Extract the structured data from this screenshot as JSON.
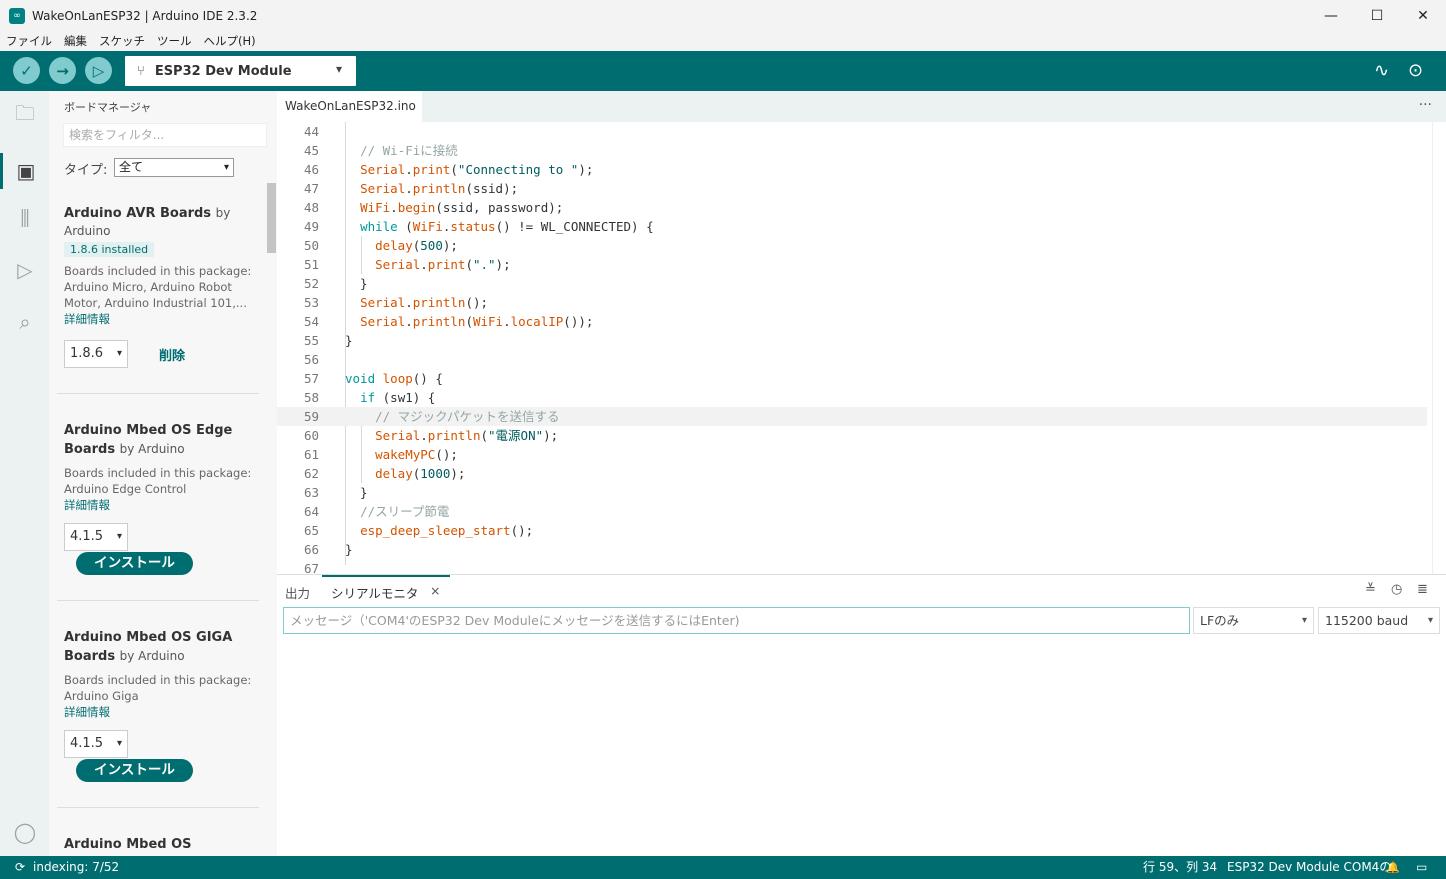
{
  "window": {
    "title": "WakeOnLanESP32 | Arduino IDE 2.3.2",
    "logo_glyph": "∞",
    "minimize": "—",
    "maximize": "☐",
    "close": "✕"
  },
  "menu": [
    "ファイル",
    "編集",
    "スケッチ",
    "ツール",
    "ヘルプ(H)"
  ],
  "toolbar": {
    "verify_icon": "✓",
    "upload_icon": "→",
    "debug_icon": "▷",
    "board_icon": "⑂",
    "board": "ESP32 Dev Module",
    "board_arrow": "▾",
    "plotter_icon": "∿",
    "monitor_icon": "⊙"
  },
  "activity": {
    "sketchbook_icon": "🗀",
    "boards_icon": "▣",
    "library_icon": "⫼",
    "debug_icon": "▷",
    "search_icon": "⌕",
    "account_icon": "◯"
  },
  "board_manager": {
    "title": "ボードマネージャ",
    "filter_placeholder": "検索をフィルタ...",
    "type_label": "タイプ:",
    "type_value": "全て",
    "dropdown_arrow": "▾",
    "packages": [
      {
        "name": "Arduino AVR Boards",
        "by": "by",
        "author": "Arduino",
        "badge": "1.8.6 installed",
        "desc": "Boards included in this package: Arduino Micro, Arduino Robot Motor, Arduino Industrial 101,...",
        "more": "詳細情報",
        "version": "1.8.6",
        "action": "削除"
      },
      {
        "name": "Arduino Mbed OS Edge",
        "name2": "Boards",
        "by": "by Arduino",
        "desc": "Boards included in this package: Arduino Edge Control",
        "more": "詳細情報",
        "version": "4.1.5",
        "action": "インストール"
      },
      {
        "name": "Arduino Mbed OS GIGA",
        "name2": "Boards",
        "by": "by Arduino",
        "desc": "Boards included in this package: Arduino Giga",
        "more": "詳細情報",
        "version": "4.1.5",
        "action": "インストール"
      },
      {
        "name": "Arduino Mbed OS"
      }
    ]
  },
  "editor": {
    "tab": "WakeOnLanESP32.ino",
    "more_icon": "···",
    "current_line": 59,
    "lines": [
      {
        "n": "44",
        "html": ""
      },
      {
        "n": "45",
        "html": "  <span class=\"cm\">// Wi-Fiに接続</span>"
      },
      {
        "n": "46",
        "html": "  <span class=\"fn\">Serial</span>.<span class=\"fn\">print</span>(<span class=\"str\">\"Connecting to \"</span>);"
      },
      {
        "n": "47",
        "html": "  <span class=\"fn\">Serial</span>.<span class=\"fn\">println</span>(ssid);"
      },
      {
        "n": "48",
        "html": "  <span class=\"fn\">WiFi</span>.<span class=\"fn\">begin</span>(ssid, password);"
      },
      {
        "n": "49",
        "html": "  <span class=\"kw\">while</span> (<span class=\"fn\">WiFi</span>.<span class=\"fn\">status</span>() != WL_CONNECTED) {"
      },
      {
        "n": "50",
        "html": "    <span class=\"fn\">delay</span>(<span class=\"str\">500</span>);"
      },
      {
        "n": "51",
        "html": "    <span class=\"fn\">Serial</span>.<span class=\"fn\">print</span>(<span class=\"str\">\".\"</span>);"
      },
      {
        "n": "52",
        "html": "  }"
      },
      {
        "n": "53",
        "html": "  <span class=\"fn\">Serial</span>.<span class=\"fn\">println</span>();"
      },
      {
        "n": "54",
        "html": "  <span class=\"fn\">Serial</span>.<span class=\"fn\">println</span>(<span class=\"fn\">WiFi</span>.<span class=\"fn\">localIP</span>());"
      },
      {
        "n": "55",
        "html": "}"
      },
      {
        "n": "56",
        "html": ""
      },
      {
        "n": "57",
        "html": "<span class=\"kw\">void</span> <span class=\"fn\">loop</span>() {"
      },
      {
        "n": "58",
        "html": "  <span class=\"kw\">if</span> (sw1) {"
      },
      {
        "n": "59",
        "html": "    <span class=\"cm\">// マジックパケットを送信する</span>"
      },
      {
        "n": "60",
        "html": "    <span class=\"fn\">Serial</span>.<span class=\"fn\">println</span>(<span class=\"str\">\"電源ON\"</span>);"
      },
      {
        "n": "61",
        "html": "    <span class=\"fn\">wakeMyPC</span>();"
      },
      {
        "n": "62",
        "html": "    <span class=\"fn\">delay</span>(<span class=\"str\">1000</span>);"
      },
      {
        "n": "63",
        "html": "  }"
      },
      {
        "n": "64",
        "html": "  <span class=\"cm\">//スリープ節電</span>"
      },
      {
        "n": "65",
        "html": "  <span class=\"fn\">esp_deep_sleep_start</span>();"
      },
      {
        "n": "66",
        "html": "}"
      },
      {
        "n": "67",
        "html": ""
      }
    ]
  },
  "panel": {
    "output_tab": "出力",
    "monitor_tab": "シリアルモニタ",
    "close_icon": "×",
    "collapse_icon": "≚",
    "timestamp_icon": "◷",
    "clear_icon": "≣",
    "message_placeholder": "メッセージ（'COM4'のESP32 Dev Moduleにメッセージを送信するにはEnter)",
    "line_ending": "LFのみ",
    "baud": "115200 baud",
    "dropdown_arrow": "▾"
  },
  "status": {
    "sync_icon": "⟳",
    "indexing": "indexing: 7/52",
    "cursor": "行 59、列 34",
    "board_port": "ESP32 Dev Module COM4の",
    "bell_icon": "🔔",
    "layout_icon": "▭"
  },
  "colors": {
    "brand": "#006d70",
    "accent_light": "#7fcbcd"
  }
}
